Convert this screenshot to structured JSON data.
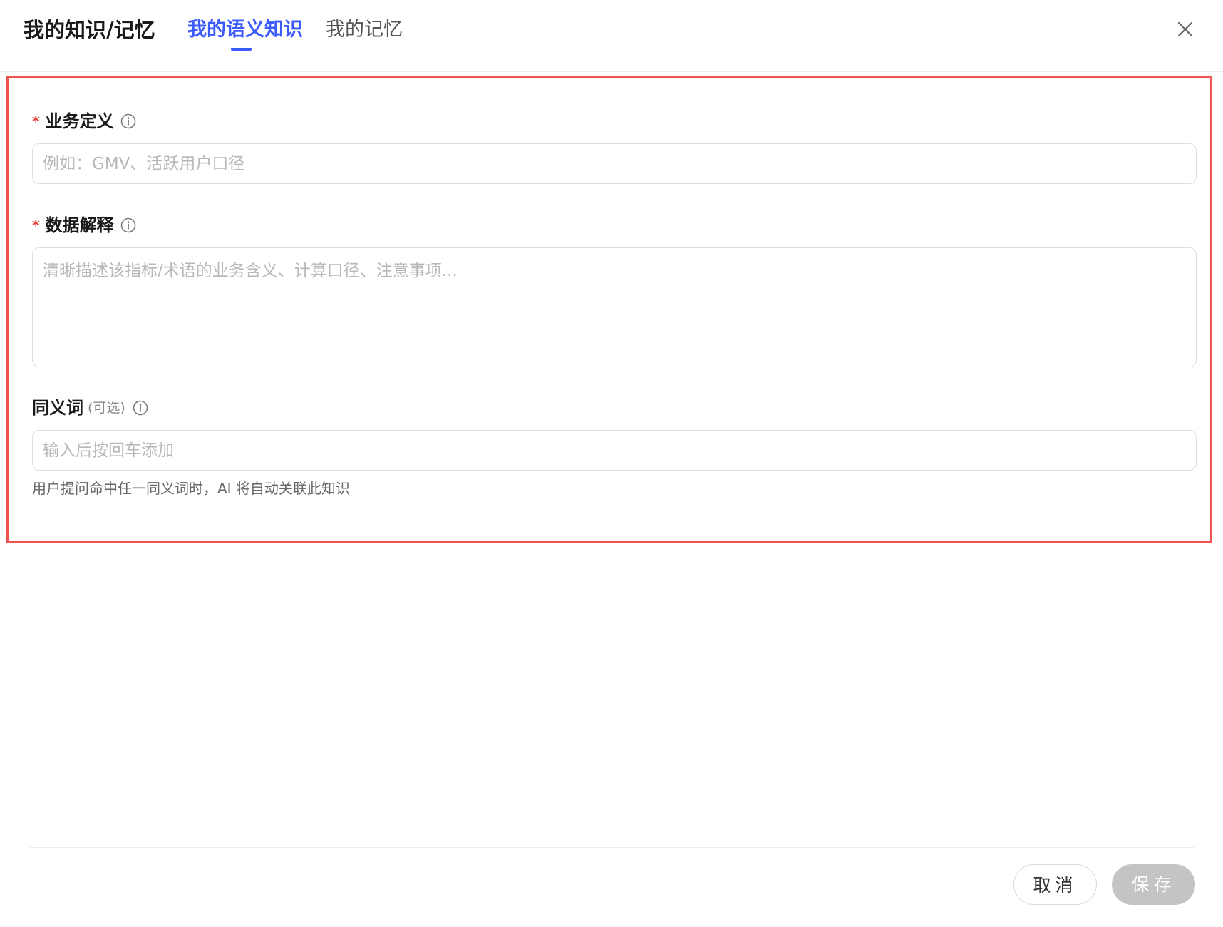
{
  "header": {
    "title": "我的知识/记忆",
    "tabs": [
      {
        "label": "我的语义知识",
        "active": true
      },
      {
        "label": "我的记忆",
        "active": false
      }
    ]
  },
  "form": {
    "business_definition": {
      "required_mark": "*",
      "label": "业务定义",
      "placeholder": "例如：GMV、活跃用户口径",
      "value": ""
    },
    "data_explanation": {
      "required_mark": "*",
      "label": "数据解释",
      "placeholder": "清晰描述该指标/术语的业务含义、计算口径、注意事项...",
      "value": ""
    },
    "synonyms": {
      "label": "同义词",
      "optional_hint": "(可选)",
      "placeholder": "输入后按回车添加",
      "value": "",
      "helper": "用户提问命中任一同义词时，AI 将自动关联此知识"
    }
  },
  "footer": {
    "cancel_label": "取消",
    "save_label": "保存"
  },
  "colors": {
    "accent": "#3b5bfd",
    "required": "#e53935",
    "highlight_border": "#ef5350",
    "save_disabled": "#c4c4c4"
  },
  "icons": {
    "close": "close-icon",
    "info": "info-circle-icon"
  }
}
